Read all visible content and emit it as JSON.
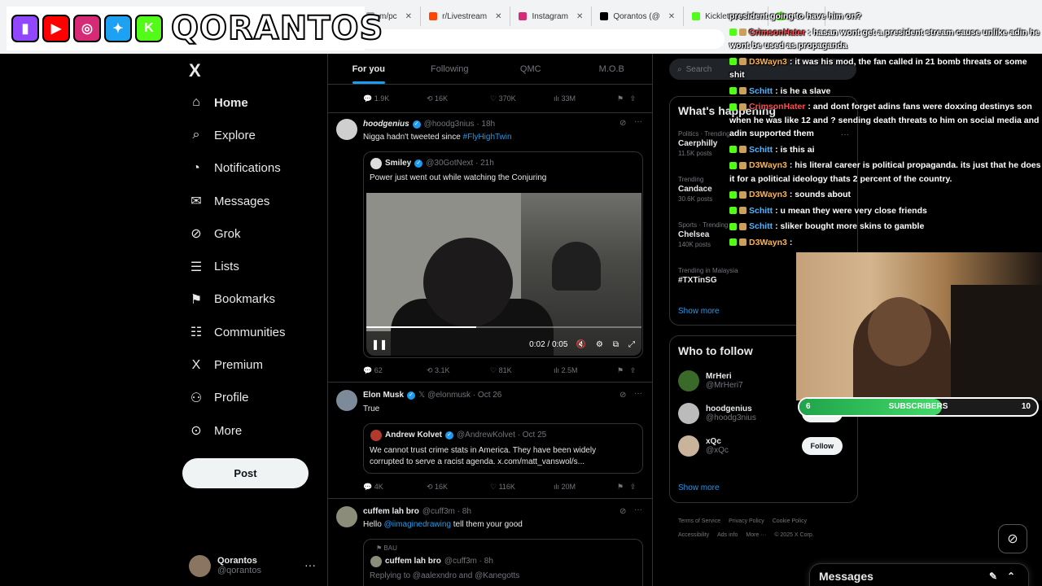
{
  "browser": {
    "tabs": [
      {
        "label": "m/pc",
        "color": "#9aa0a6"
      },
      {
        "label": "r/Livestream",
        "color": "#ff4500"
      },
      {
        "label": "Instagram",
        "color": "#d62976"
      },
      {
        "label": "Qorantos (@",
        "color": "#000000"
      },
      {
        "label": "Kicklet.app",
        "color": "#53fc18"
      },
      {
        "label": "Kic",
        "color": "#53fc18"
      }
    ]
  },
  "banner": {
    "brand": "QORANTOS",
    "icons": [
      {
        "name": "twitch-icon",
        "glyph": "▮",
        "color": "#9146ff"
      },
      {
        "name": "youtube-icon",
        "glyph": "▶",
        "color": "#ff0000"
      },
      {
        "name": "instagram-icon",
        "glyph": "◎",
        "color": "#d62976"
      },
      {
        "name": "twitter-icon",
        "glyph": "✦",
        "color": "#1da1f2"
      },
      {
        "name": "kick-icon",
        "glyph": "K",
        "color": "#53fc18"
      }
    ]
  },
  "sidebar": {
    "logo": "X",
    "items": [
      {
        "label": "Home",
        "icon": "⌂",
        "icon_name": "home-icon"
      },
      {
        "label": "Explore",
        "icon": "⌕",
        "icon_name": "search-icon"
      },
      {
        "label": "Notifications",
        "icon": "◔",
        "icon_name": "bell-icon"
      },
      {
        "label": "Messages",
        "icon": "✉",
        "icon_name": "envelope-icon"
      },
      {
        "label": "Grok",
        "icon": "⊘",
        "icon_name": "grok-icon"
      },
      {
        "label": "Lists",
        "icon": "☰",
        "icon_name": "list-icon"
      },
      {
        "label": "Bookmarks",
        "icon": "⚑",
        "icon_name": "bookmark-icon"
      },
      {
        "label": "Communities",
        "icon": "☷",
        "icon_name": "people-icon"
      },
      {
        "label": "Premium",
        "icon": "X",
        "icon_name": "x-premium-icon"
      },
      {
        "label": "Profile",
        "icon": "⚇",
        "icon_name": "person-icon"
      },
      {
        "label": "More",
        "icon": "⊙",
        "icon_name": "more-circle-icon"
      }
    ],
    "post_label": "Post",
    "account": {
      "name": "Qorantos",
      "handle": "@qorantos",
      "menu": "···"
    }
  },
  "feed": {
    "tabs": [
      "For you",
      "Following",
      "QMC",
      "M.O.B"
    ],
    "prev_actions": {
      "replies": "1.9K",
      "reposts": "16K",
      "likes": "370K",
      "views": "33M"
    },
    "post1": {
      "name": "hoodgenius",
      "handle": "@hoodg3nius · 18h",
      "text": "Nigga hadn't tweeted since ",
      "hashtag": "#FlyHighTwin",
      "quote": {
        "name": "Smiley",
        "handle": "@30GotNext · 21h",
        "text": "Power just went out while watching the Conjuring"
      },
      "video": {
        "time": "0:02 / 0:05",
        "progress": 0.4
      },
      "actions": {
        "replies": "62",
        "reposts": "3.1K",
        "likes": "81K",
        "views": "2.5M"
      }
    },
    "post2": {
      "name": "Elon Musk",
      "handle": "@elonmusk · Oct 26",
      "text": "True",
      "quote": {
        "name": "Andrew Kolvet",
        "handle": "@AndrewKolvet · Oct 25",
        "text": "We cannot trust crime stats in America. They have been widely corrupted to serve a racist agenda. x.com/matt_vanswol/s..."
      },
      "actions": {
        "replies": "4K",
        "reposts": "16K",
        "likes": "116K",
        "views": "20M"
      }
    },
    "post3": {
      "name": "cuffem lah bro",
      "handle": "@cuff3m · 8h",
      "text_prefix": "Hello ",
      "mention": "@iimaginedrawing",
      "text_suffix": " tell them your good",
      "quote": {
        "tag": "BAU",
        "name": "cuffem lah bro",
        "handle": "@cuff3m · 8h",
        "text": "Replying to @aalexndro and @Kanegotts"
      }
    }
  },
  "right": {
    "search_placeholder": "Search",
    "happening_title": "What's happening",
    "trends": [
      {
        "category": "Politics · Trending",
        "name": "Caerphilly",
        "count": "11.5K posts"
      },
      {
        "category": "Trending",
        "name": "Candace",
        "count": "30.6K posts"
      },
      {
        "category": "Sports · Trending",
        "name": "Chelsea",
        "count": "140K posts"
      },
      {
        "category": "Trending in Malaysia",
        "name": "#TXTinSG",
        "count": ""
      }
    ],
    "show_more": "Show more",
    "wtf_title": "Who to follow",
    "wtf": [
      {
        "name": "MrHeri",
        "handle": "@MrHeri7",
        "color": "#3a6a2a"
      },
      {
        "name": "hoodgenius",
        "handle": "@hoodg3nius",
        "color": "#bbbbbb"
      },
      {
        "name": "xQc",
        "handle": "@xQc",
        "color": "#c9b39a"
      }
    ],
    "follow_label": "Follow",
    "show_more2": "Show more",
    "footer": [
      "Terms of Service",
      "Privacy Policy",
      "Cookie Policy",
      "Accessibility",
      "Ads info",
      "More ···",
      "© 2025 X Corp."
    ],
    "messages_label": "Messages"
  },
  "chat": [
    {
      "user": "",
      "color": "#ffffff",
      "text": "president going to have him on?"
    },
    {
      "user": "CrimsonHater",
      "color": "#ff4d4d",
      "text": ": hasan wont get a president stream cause unlike adin he wont be used as propaganda"
    },
    {
      "user": "D3Wayn3",
      "color": "#ffb347",
      "text": ": it was his mod, the fan called in 21 bomb threats or some shit"
    },
    {
      "user": "Schitt",
      "color": "#4fb3ff",
      "text": ": is he a slave"
    },
    {
      "user": "CrimsonHater",
      "color": "#ff4d4d",
      "text": ": and dont forget adins fans were doxxing destinys son when he was like 12 and ? sending death threats to him on social media and adin supported them"
    },
    {
      "user": "Schitt",
      "color": "#4fb3ff",
      "text": ": is this ai"
    },
    {
      "user": "D3Wayn3",
      "color": "#ffb347",
      "text": ": his literal career is political propaganda. its just that he does it for a political ideology thats 2 percent of the country."
    },
    {
      "user": "D3Wayn3",
      "color": "#ffb347",
      "text": ": sounds about"
    },
    {
      "user": "Schitt",
      "color": "#4fb3ff",
      "text": ": u mean they were very close friends"
    },
    {
      "user": "Schitt",
      "color": "#4fb3ff",
      "text": ": sliker bought more skins to gamble"
    },
    {
      "user": "D3Wayn3",
      "color": "#ffb347",
      "text": ":"
    }
  ],
  "subbar": {
    "left": "6",
    "label": "SUBSCRIBERS",
    "right": "10",
    "progress": 0.6
  }
}
